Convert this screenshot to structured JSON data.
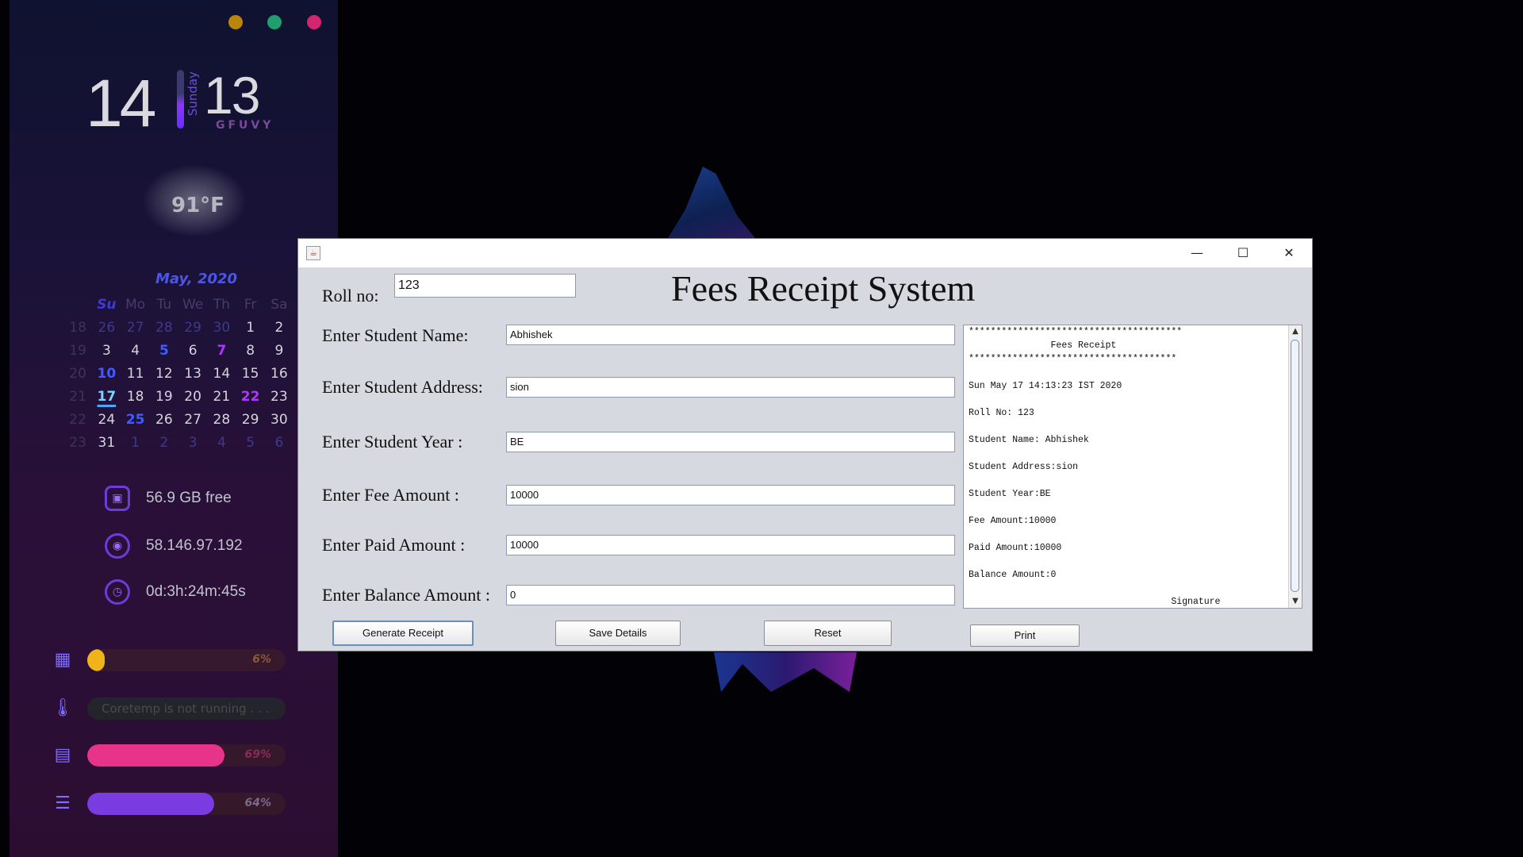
{
  "desktop": {
    "clock": {
      "hour": "14",
      "minute": "13",
      "day": "Sunday",
      "brand": "GFUVY"
    },
    "weather": {
      "temperature": "91°F"
    },
    "calendar": {
      "title": "May, 2020",
      "headers": [
        "",
        "Su",
        "Mo",
        "Tu",
        "We",
        "Th",
        "Fr",
        "Sa"
      ],
      "weeks": [
        [
          "18",
          "26",
          "27",
          "28",
          "29",
          "30",
          "1",
          "2"
        ],
        [
          "19",
          "3",
          "4",
          "5",
          "6",
          "7",
          "8",
          "9"
        ],
        [
          "20",
          "10",
          "11",
          "12",
          "13",
          "14",
          "15",
          "16"
        ],
        [
          "21",
          "17",
          "18",
          "19",
          "20",
          "21",
          "22",
          "23"
        ],
        [
          "22",
          "24",
          "25",
          "26",
          "27",
          "28",
          "29",
          "30"
        ],
        [
          "23",
          "31",
          "1",
          "2",
          "3",
          "4",
          "5",
          "6"
        ]
      ]
    },
    "stats": {
      "disk": "56.9 GB free",
      "ip": "58.146.97.192",
      "uptime": "0d:3h:24m:45s"
    },
    "meters": {
      "cpu": {
        "label": "6%",
        "value": 0.06,
        "color": "#f0b419"
      },
      "temp": {
        "message": "Coretemp is not running . . ."
      },
      "ram": {
        "label": "69%",
        "value": 0.69,
        "color": "#e8338a"
      },
      "storage": {
        "label": "64%",
        "value": 0.64,
        "color": "#7a3be0"
      }
    },
    "dots": [
      "#b8860b",
      "#1f9e6e",
      "#d4266e"
    ]
  },
  "window": {
    "title_icon": "java-icon",
    "controls": {
      "minimize": "—",
      "maximize": "☐",
      "close": "✕"
    },
    "heading": "Fees Receipt System",
    "roll": {
      "label": "Roll no:",
      "value": "123"
    },
    "fields": {
      "name": {
        "label": "Enter Student Name:",
        "value": "Abhishek"
      },
      "address": {
        "label": "Enter Student Address:",
        "value": "sion"
      },
      "year": {
        "label": "Enter Student Year :",
        "value": "BE"
      },
      "fee": {
        "label": "Enter Fee Amount :",
        "value": "10000"
      },
      "paid": {
        "label": "Enter Paid Amount :",
        "value": "10000"
      },
      "balance": {
        "label": "Enter Balance Amount :",
        "value": "0"
      }
    },
    "buttons": {
      "generate": "Generate Receipt",
      "save": "Save Details",
      "reset": "Reset",
      "print": "Print"
    },
    "receipt": {
      "stars_top": "***************************************",
      "title": "               Fees Receipt",
      "stars_bottom": "**************************************",
      "date": "Sun May 17 14:13:23 IST 2020",
      "roll": "Roll No: 123",
      "name": "Student Name: Abhishek",
      "address": "Student Address:sion",
      "year": "Student Year:BE",
      "fee": "Fee Amount:10000",
      "paid": "Paid Amount:10000",
      "balance": "Balance Amount:0",
      "signature": "                                     Signature"
    }
  }
}
